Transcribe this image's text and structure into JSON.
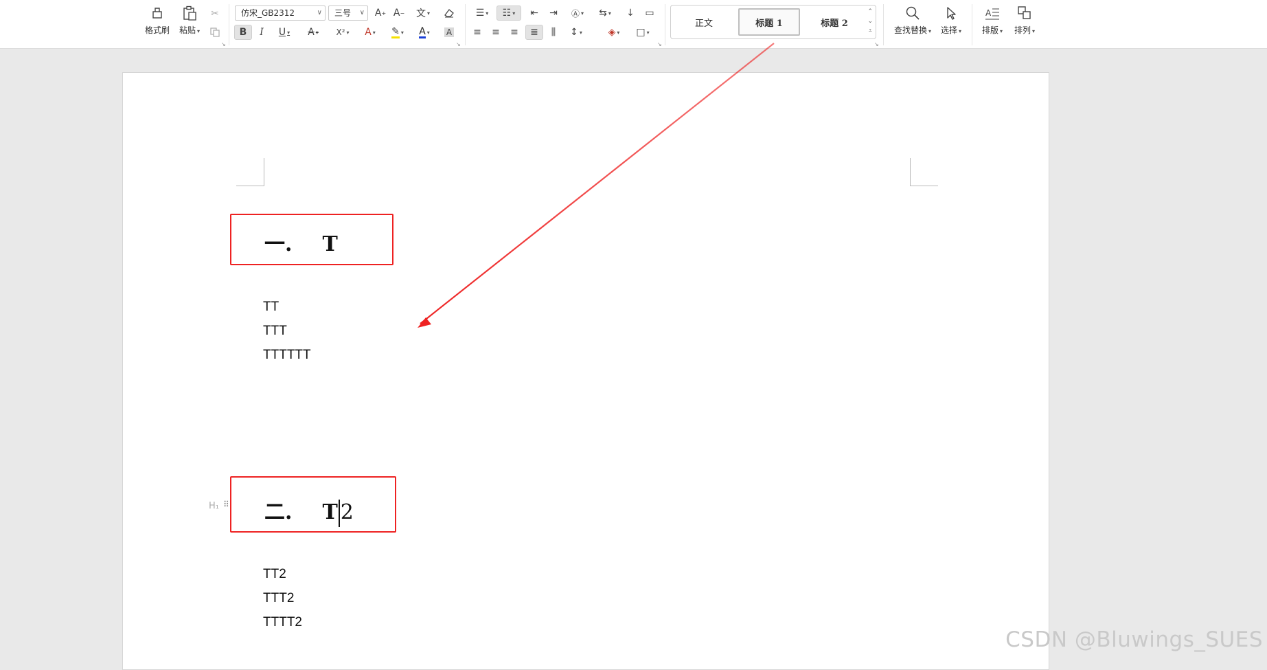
{
  "ribbon": {
    "clipboard": {
      "format_painter": "格式刷",
      "paste": "粘贴"
    },
    "font": {
      "family": "仿宋_GB2312",
      "size": "三号",
      "bold": "B",
      "italic": "I",
      "underline": "U",
      "superscript": "X²",
      "char_shading": "A"
    },
    "styles": {
      "items": [
        "正文",
        "标题  1",
        "标题  2"
      ],
      "selected": "标题  1"
    },
    "find_replace": "查找替换",
    "select": "选择",
    "layout": "排版",
    "arrange": "排列"
  },
  "document": {
    "heading1": {
      "number": "一.",
      "text": "T"
    },
    "section1_lines": [
      "TT",
      "TTT",
      "TTTTTT"
    ],
    "heading2": {
      "number": "二.",
      "text_before_cursor": "T",
      "text_after_cursor": "2"
    },
    "heading_marker": "H₁",
    "section2_lines": [
      "TT2",
      "TTT2",
      "TTTT2"
    ]
  },
  "colors": {
    "annotation_red": "#ee2222",
    "highlight_yellow": "#f5e100",
    "font_color_blue": "#1a3fd6"
  },
  "watermark": "CSDN @Bluwings_SUES"
}
